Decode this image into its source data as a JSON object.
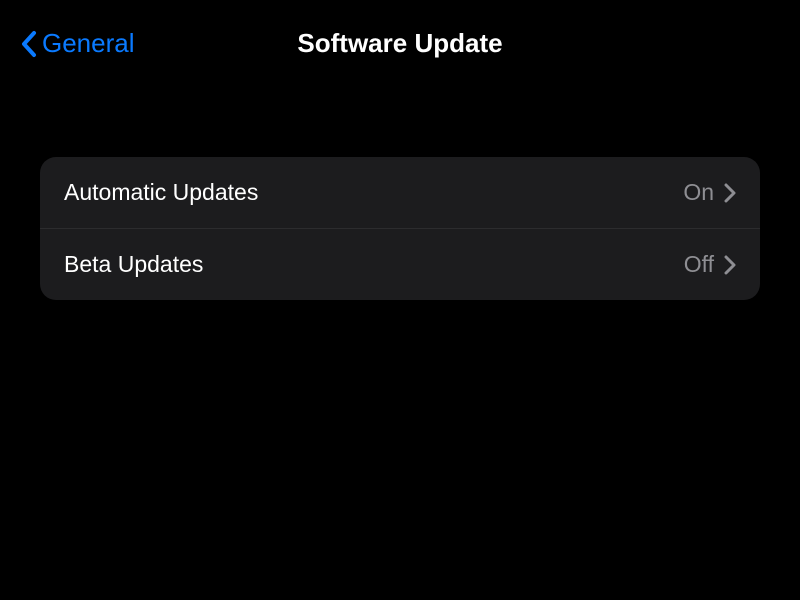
{
  "header": {
    "back_label": "General",
    "title": "Software Update"
  },
  "settings": {
    "rows": [
      {
        "label": "Automatic Updates",
        "value": "On"
      },
      {
        "label": "Beta Updates",
        "value": "Off"
      }
    ]
  },
  "colors": {
    "accent": "#0a7aff",
    "secondary_text": "#8e8e93",
    "group_bg": "#1c1c1e"
  }
}
